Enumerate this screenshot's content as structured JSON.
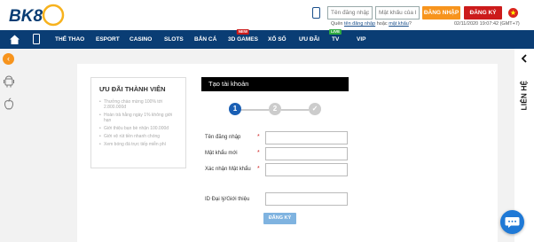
{
  "header": {
    "logo_text": "BK8",
    "username_placeholder": "Tên đăng nhập",
    "password_placeholder": "Mật khẩu của bạn",
    "login_label": "ĐĂNG NHẬP",
    "register_label": "ĐĂNG KÝ",
    "forgot_prefix": "Quên",
    "forgot_username": "tên đăng nhập",
    "forgot_or": "hoặc",
    "forgot_password": "mật khẩu",
    "forgot_suffix": "?",
    "datetime": "02/11/2020 19:07:42 (GMT+7)"
  },
  "nav": {
    "items": [
      {
        "label": "THỂ THAO"
      },
      {
        "label": "ESPORT"
      },
      {
        "label": "CASINO"
      },
      {
        "label": "SLOTS"
      },
      {
        "label": "BẮN CÁ"
      },
      {
        "label": "3D GAMES",
        "badge": "NEW"
      },
      {
        "label": "XỔ SỐ"
      },
      {
        "label": "ƯU ĐÃI"
      },
      {
        "label": "TV",
        "badge": "LIVE"
      },
      {
        "label": "VIP"
      }
    ]
  },
  "right_rail": {
    "label": "LIÊN HỆ"
  },
  "promo": {
    "title": "ƯU ĐÃI THÀNH VIÊN",
    "items": [
      "Thưởng chào mừng 100% tới 2.800.000đ",
      "Hoàn trả hằng ngày 1% không giới hạn",
      "Giới thiệu bạn bè nhận 100.000đ",
      "Giới vệ rút tiền nhanh chóng",
      "Xem bóng đá trực tiếp miễn phí"
    ]
  },
  "form": {
    "title": "Tạo tài khoản",
    "steps": [
      "1",
      "2",
      "✓"
    ],
    "fields": {
      "username_label": "Tên đăng nhập",
      "password_label": "Mật khẩu mới",
      "confirm_label": "Xác nhận Mật khẩu",
      "referral_label": "ID Đại lý/Giới thiệu",
      "required_mark": "*"
    },
    "submit_label": "ĐĂNG KÝ"
  },
  "colors": {
    "nav_bg": "#0a3d74",
    "login_orange": "#f7941d",
    "register_red": "#cc1b1b",
    "step_active": "#1a5fb4",
    "step_inactive": "#cccccc",
    "submit_blue": "#7fb3e0",
    "chat_blue": "#1f79d6"
  },
  "icons": {
    "phone": "phone-icon",
    "home": "home-icon",
    "flag": "vietnam-flag-icon",
    "back": "back-arrow-icon",
    "android": "android-icon",
    "apple": "apple-icon",
    "chat": "chat-icon"
  }
}
